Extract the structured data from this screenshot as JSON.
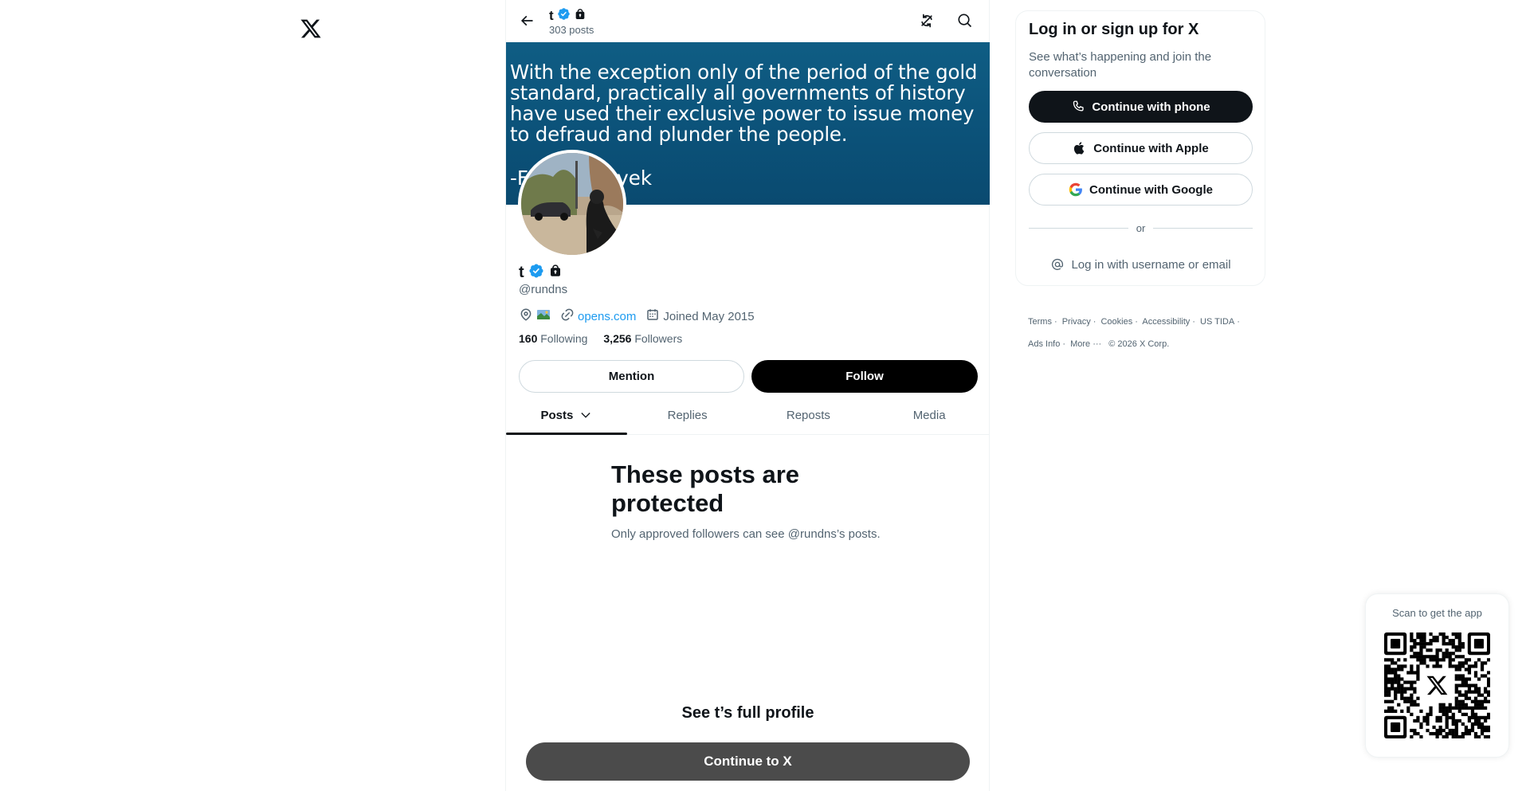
{
  "app": {
    "logo": "x-logo-icon"
  },
  "header": {
    "name": "t",
    "post_count": "303 posts",
    "back_icon": "arrow-left-icon",
    "refresh_icon": "refresh-icon",
    "search_icon": "search-icon"
  },
  "banner": {
    "quote": "With the exception only of the period of the gold standard, practically all governments of history have used their exclusive power to issue money to defraud and plunder the people.",
    "author": "-F          Hayek"
  },
  "profile": {
    "name": "t",
    "handle": "@rundns",
    "website": "opens.com",
    "joined": "Joined May 2015",
    "following_count": "160",
    "following_label": "Following",
    "followers_count": "3,256",
    "followers_label": "Followers",
    "verified_color": "#1d9bf0"
  },
  "actions": {
    "mention": "Mention",
    "follow": "Follow"
  },
  "tabs": [
    {
      "label": "Posts",
      "active": true
    },
    {
      "label": "Replies",
      "active": false
    },
    {
      "label": "Reposts",
      "active": false
    },
    {
      "label": "Media",
      "active": false
    }
  ],
  "protected": {
    "title": "These posts are protected",
    "subtitle": "Only approved followers can see @rundns’s posts."
  },
  "cta": {
    "full_profile": "See t’s full profile",
    "continue": "Continue to X"
  },
  "login": {
    "title": "Log in or sign up for X",
    "subtitle": "See what’s happening and join the conversation",
    "phone": "Continue with phone",
    "apple": "Continue with Apple",
    "google": "Continue with Google",
    "or": "or",
    "username": "Log in with username or email"
  },
  "footer": {
    "terms": "Terms",
    "privacy": "Privacy",
    "cookies": "Cookies",
    "accessibility": "Accessibility",
    "us_tida": "US TIDA",
    "ads_info": "Ads Info",
    "more": "More ···",
    "copyright": "© 2026 X Corp."
  },
  "qr": {
    "label": "Scan to get the app"
  }
}
